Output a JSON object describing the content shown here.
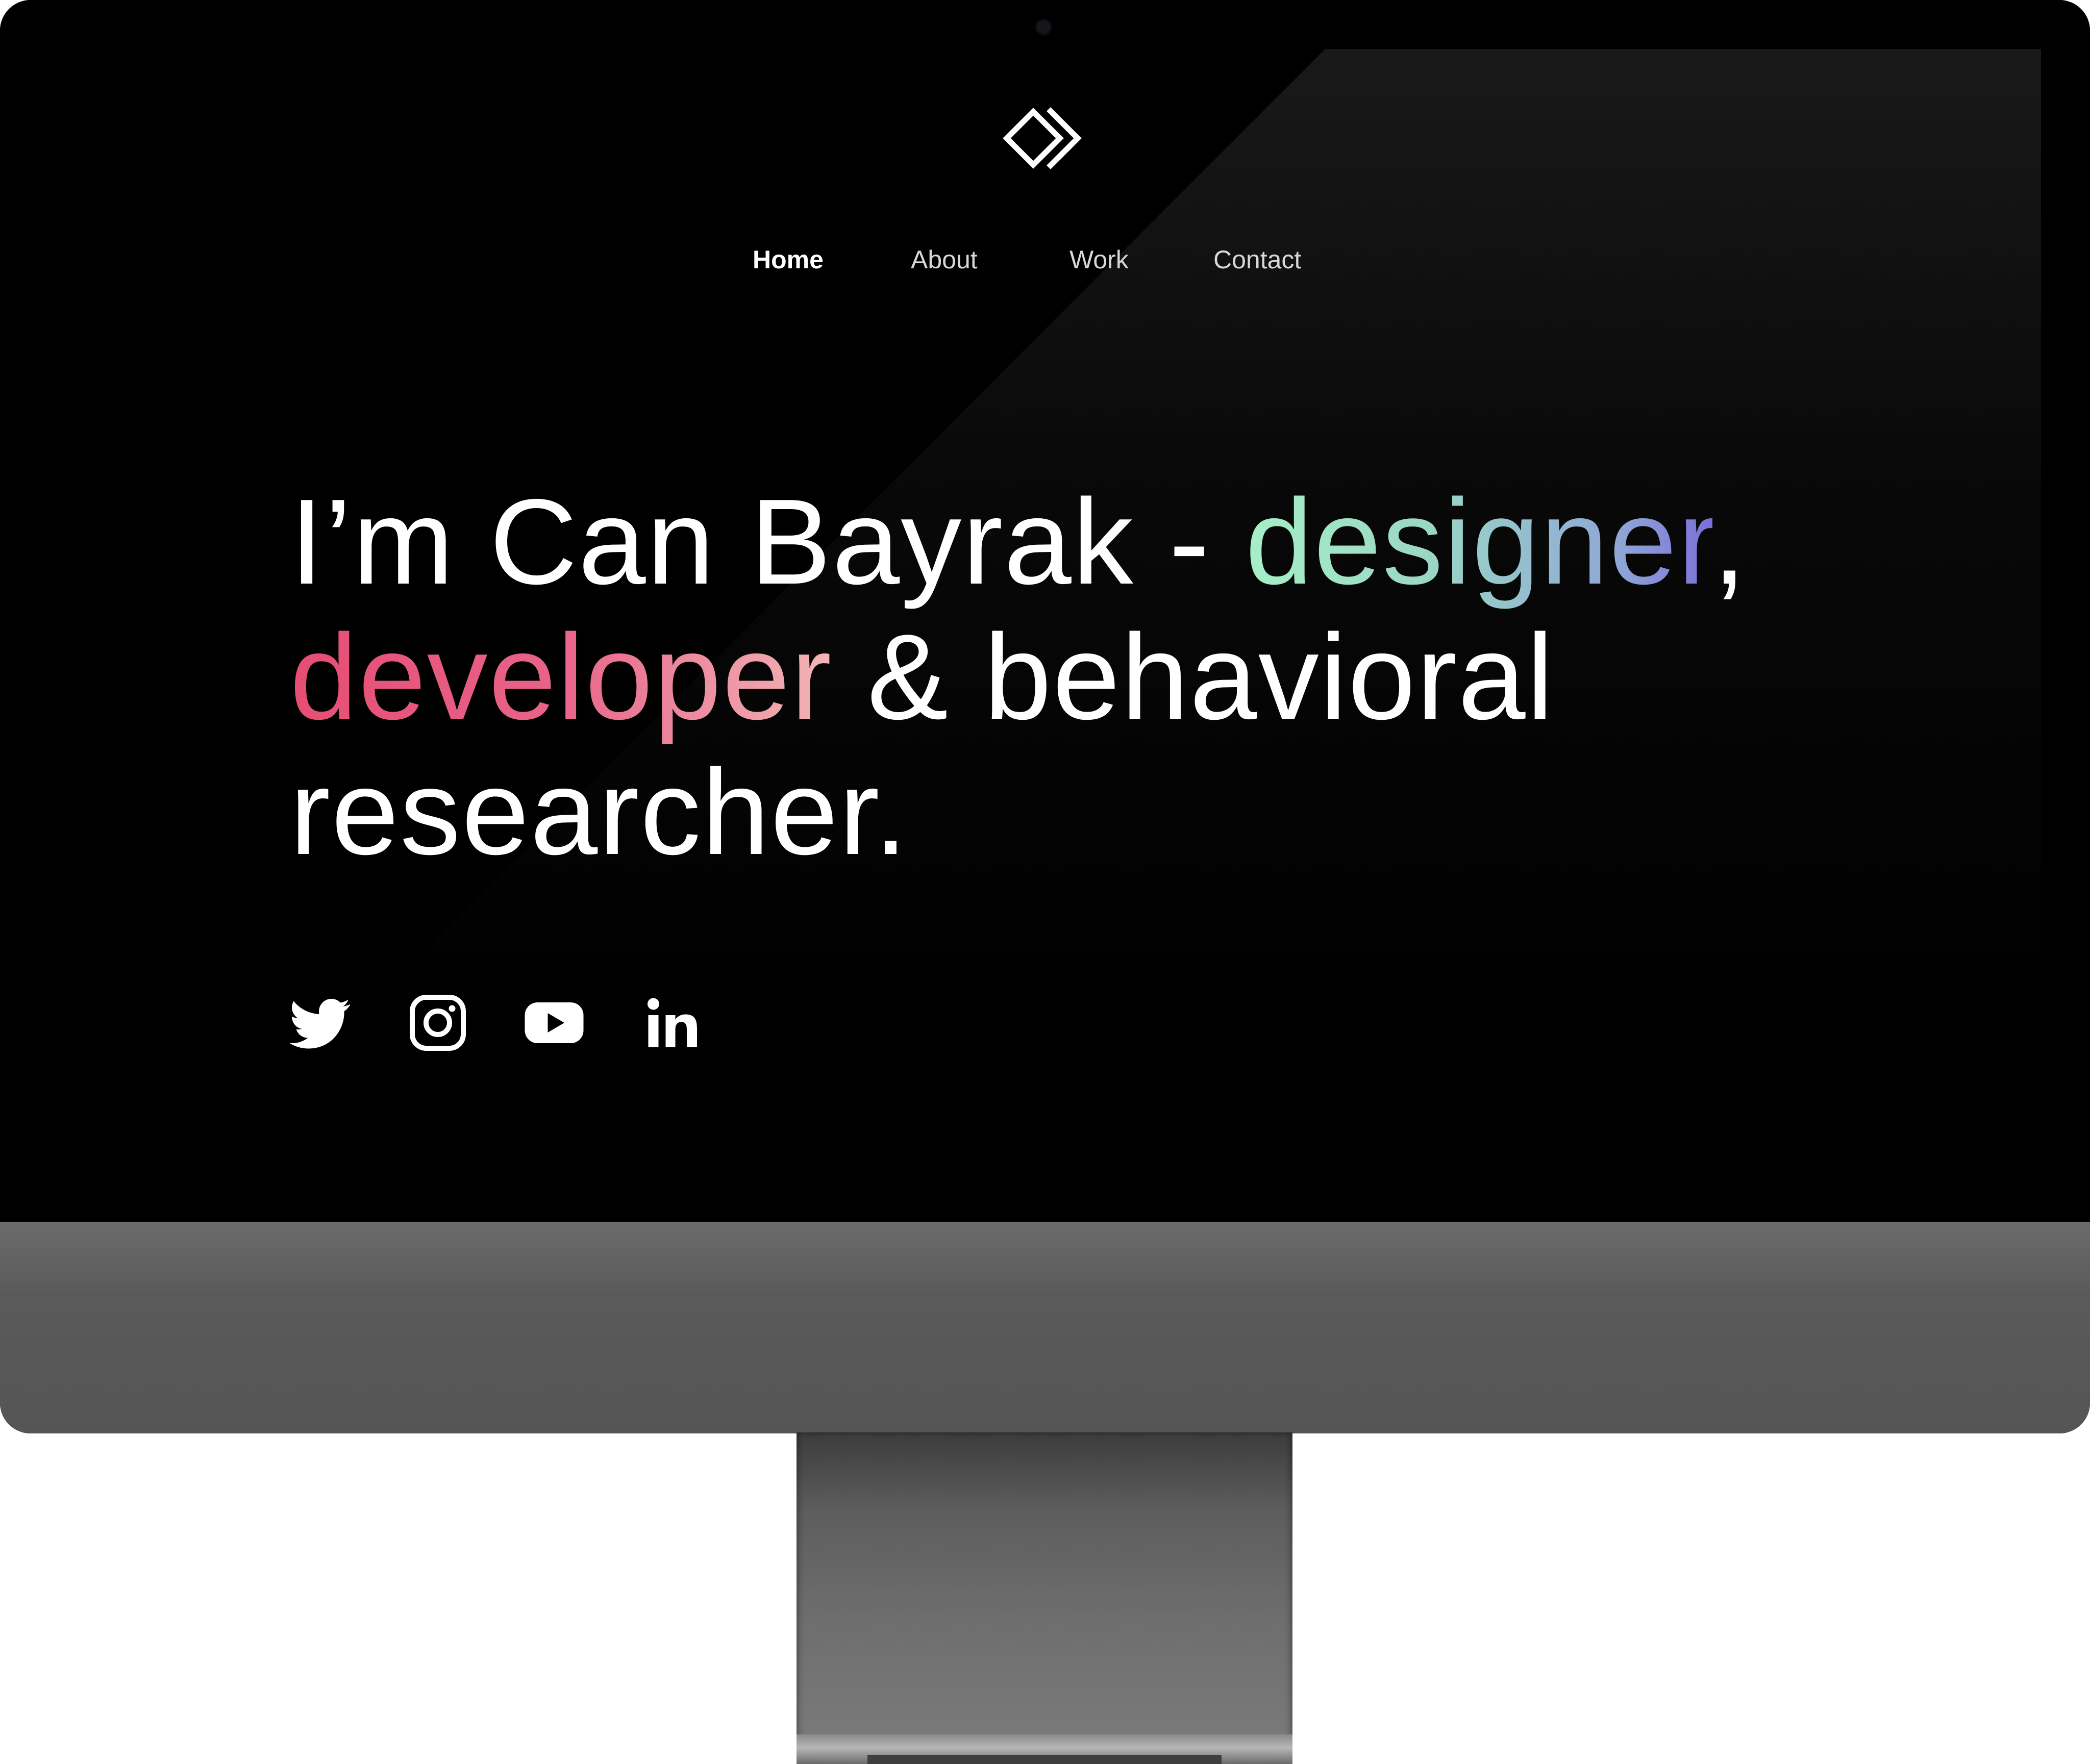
{
  "nav": {
    "items": [
      {
        "label": "Home",
        "active": true
      },
      {
        "label": "About",
        "active": false
      },
      {
        "label": "Work",
        "active": false
      },
      {
        "label": "Contact",
        "active": false
      }
    ]
  },
  "hero": {
    "line1_prefix": "I’m Can Bayrak - ",
    "line1_highlight": "designer",
    "line1_suffix": ",",
    "line2_highlight": "developer",
    "line2_suffix": " & behavioral",
    "line3": "researcher."
  },
  "socials": [
    {
      "icon": "twitter-icon"
    },
    {
      "icon": "instagram-icon"
    },
    {
      "icon": "youtube-icon"
    },
    {
      "icon": "linkedin-icon"
    }
  ],
  "colors": {
    "background": "#000000",
    "text": "#ffffff",
    "designer_gradient": [
      "#a6f0c6",
      "#7b6fd8"
    ],
    "developer_gradient": [
      "#e64d74",
      "#f2b6b6"
    ],
    "chin": "#555555"
  }
}
